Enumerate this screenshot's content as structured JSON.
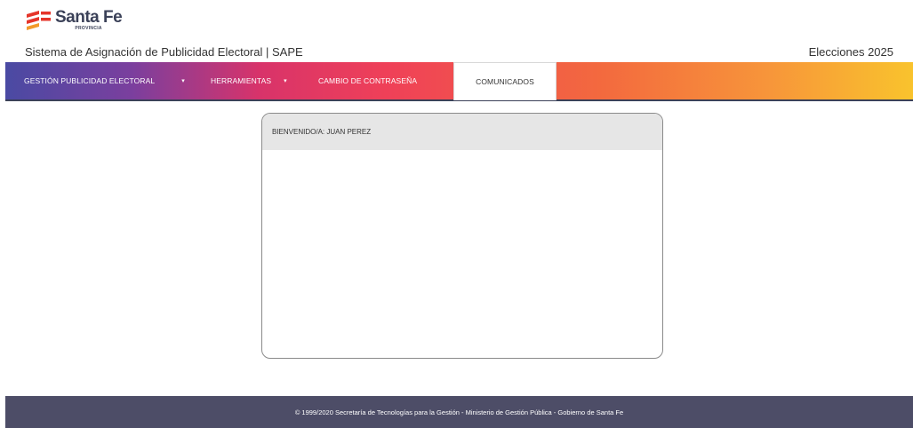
{
  "brand": {
    "name": "Santa Fe",
    "subtitle": "PROVINCIA",
    "colors": {
      "red": "#e5352a",
      "orange": "#f39a2b",
      "navy": "#3b4158"
    }
  },
  "header": {
    "app_title": "Sistema de Asignación de Publicidad Electoral | SAPE",
    "election_label": "Elecciones 2025"
  },
  "nav": {
    "items": [
      {
        "label": "GESTIÓN PUBLICIDAD ELECTORAL",
        "has_dropdown": true,
        "active": false
      },
      {
        "label": "HERRAMIENTAS",
        "has_dropdown": true,
        "active": false
      },
      {
        "label": "CAMBIO DE CONTRASEÑA",
        "has_dropdown": false,
        "active": false
      },
      {
        "label": "COMUNICADOS",
        "has_dropdown": false,
        "active": true
      }
    ],
    "caret_icon": "▾"
  },
  "panel": {
    "welcome": "BIENVENIDO/A: JUAN PEREZ"
  },
  "footer": {
    "text": "© 1999/2020 Secretaría de Tecnologías para la Gestión - Ministerio de Gestión Pública - Gobierno de Santa Fe"
  }
}
